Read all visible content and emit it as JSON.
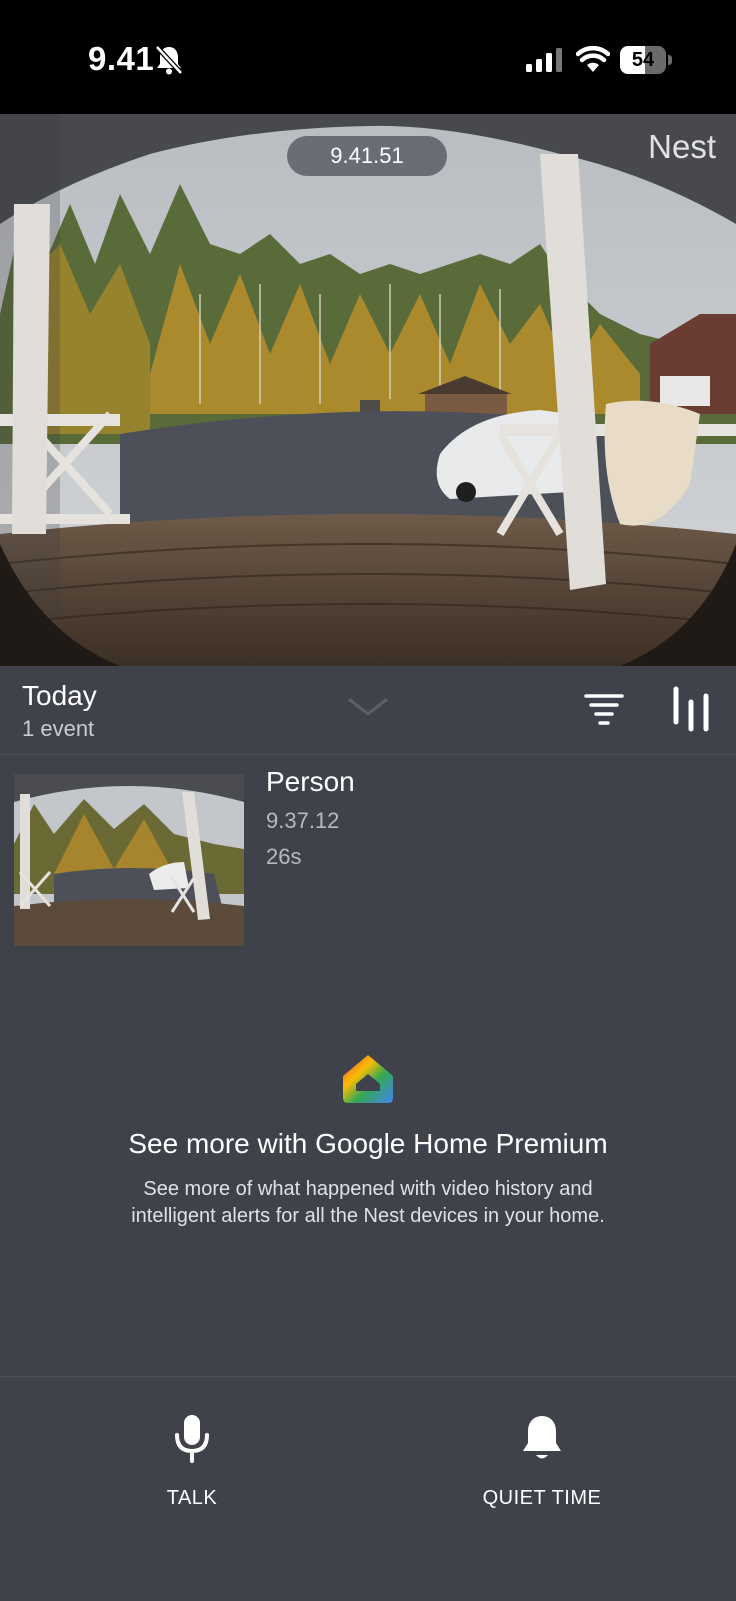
{
  "status_bar": {
    "time": "9.41",
    "battery": "54",
    "battery_level": 0.54,
    "icons": [
      "bell-slash-icon",
      "cellular-signal-icon",
      "wifi-icon",
      "battery-icon"
    ]
  },
  "camera": {
    "timestamp": "9.41.51",
    "brand": "Nest"
  },
  "events_header": {
    "title": "Today",
    "count": "1 event",
    "icons": [
      "chevron-down-icon",
      "filter-icon",
      "timeline-icon"
    ]
  },
  "events": [
    {
      "type": "Person",
      "time": "9.37.12",
      "duration": "26s"
    }
  ],
  "promo": {
    "title": "See more with Google Home Premium",
    "body": "See more of what happened with video history and intelligent alerts for all the Nest devices in your home.",
    "icon": "google-home-icon"
  },
  "actions": [
    {
      "label": "TALK",
      "icon": "microphone-icon"
    },
    {
      "label": "QUIET TIME",
      "icon": "bell-icon"
    }
  ],
  "colors": {
    "background": "#3f424b",
    "status_bar": "#000000",
    "text_primary": "#ffffff",
    "text_secondary": "#b6b9c0"
  }
}
